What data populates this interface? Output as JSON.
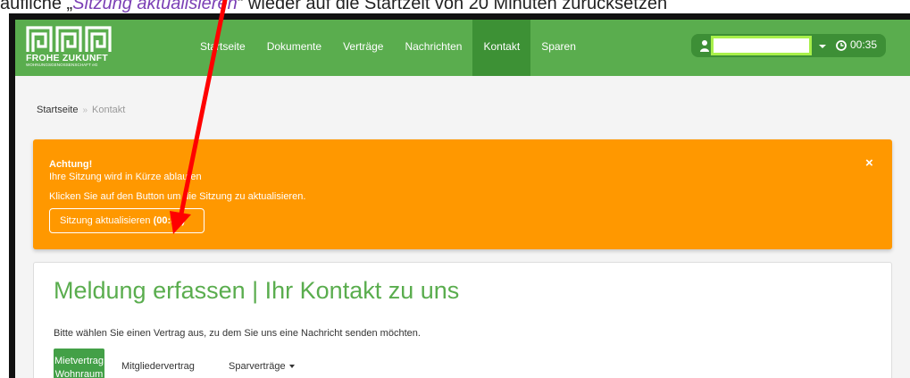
{
  "caption": {
    "prefix": "aufliche „",
    "highlight": "Sitzung aktualisieren",
    "suffix": "“ wieder auf die Startzeit von 20 Minuten zurücksetzen"
  },
  "logo": {
    "name": "FROHE ZUKUNFT",
    "subtitle": "WOHNUNGSGENOSSENSCHAFT eG"
  },
  "nav": {
    "items": [
      {
        "label": "Startseite",
        "active": false
      },
      {
        "label": "Dokumente",
        "active": false
      },
      {
        "label": "Verträge",
        "active": false
      },
      {
        "label": "Nachrichten",
        "active": false
      },
      {
        "label": "Kontakt",
        "active": true
      },
      {
        "label": "Sparen",
        "active": false
      }
    ],
    "user_value": "",
    "timer": "00:35"
  },
  "breadcrumb": {
    "home": "Startseite",
    "separator": "»",
    "current": "Kontakt"
  },
  "alert": {
    "title": "Achtung!",
    "line1": "Ihre Sitzung wird in Kürze ablaufen",
    "line2": "Klicken Sie auf den Button um die Sitzung zu aktualisieren.",
    "button_label": "Sitzung aktualisieren",
    "button_timer": "(00:35)",
    "close": "×"
  },
  "main": {
    "heading": "Meldung erfassen | Ihr Kontakt zu uns",
    "description": "Bitte wählen Sie einen Vertrag aus, zu dem Sie uns eine Nachricht senden möchten.",
    "tabs": [
      {
        "line1": "Mietvertrag",
        "line2": "Wohnraum",
        "active": true
      },
      {
        "label": "Mitgliedervertrag",
        "active": false
      },
      {
        "label": "Sparverträge",
        "active": false
      }
    ]
  },
  "colors": {
    "green": "#5aad4e",
    "dark_green": "#3d9135",
    "orange": "#ff9800",
    "arrow": "#ff0000",
    "highlight": "#7b3fb5"
  },
  "icons": [
    "user-icon",
    "clock-icon",
    "caret-down-icon",
    "close-icon",
    "annotation-arrow"
  ]
}
